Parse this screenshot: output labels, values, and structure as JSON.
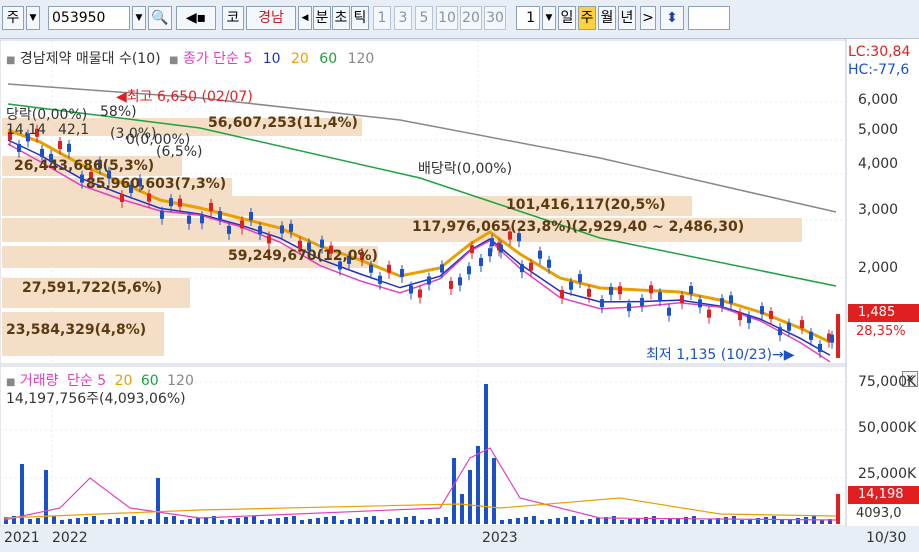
{
  "toolbar": {
    "market_label": "주",
    "code_value": "053950",
    "search_icon": "search-icon",
    "speaker_icon": "speaker-icon",
    "kosdaq_label": "코",
    "name_label": "경남",
    "prev_label": "◀",
    "minute_label": "분",
    "second_label": "초",
    "tick_label": "틱",
    "n1": "1",
    "n3": "3",
    "n5": "5",
    "n10": "10",
    "n20": "20",
    "n30": "30",
    "period_value": "1",
    "day_label": "일",
    "week_label": "주",
    "month_label": "월",
    "year_label": "년",
    "next_label": ">",
    "arrow_label": "⬍"
  },
  "price_panel": {
    "legend_title": "경남제약 매물대 수(10)",
    "legend_ma_label": "종가 단순 5",
    "ma10": "10",
    "ma20": "20",
    "ma60": "60",
    "ma120": "120",
    "lc_label": "LC:30,84",
    "hc_label": "HC:-77,6",
    "high_label": "최고 6,650 (02/07)",
    "low_label": "최저 1,135 (10/23)",
    "dividend_label": "배당락(0,00%)",
    "current_price": "1,485",
    "current_pct": "28,35%",
    "y_ticks": [
      "6,000",
      "5,000",
      "4,000",
      "3,000",
      "2,000"
    ],
    "volume_profile": [
      "56,607,253(11,4%)",
      "26,443,686(5,3%)",
      "85,960,603(7,3%)",
      "101,416,117(20,5%)",
      "117,976,065(23,8%)(2,929,40 ~ 2,486,30)",
      "59,249,670(12,0%)",
      "27,591,722(5,6%)",
      "23,584,329(4,8%)"
    ],
    "overlap_labels": [
      "당락(0,00%)",
      "14,14",
      "42,1",
      "58%)",
      "(3,0%)",
      "0(0,00%)",
      "(6,5%)"
    ]
  },
  "volume_panel": {
    "legend_title": "거래량",
    "legend_ma_label": "단순 5",
    "ma20": "20",
    "ma60": "60",
    "ma120": "120",
    "volume_value": "14,197,756주(4,093,06%)",
    "y_ticks": [
      "75,000K",
      "50,000K",
      "25,000K"
    ],
    "current_volume": "14,198",
    "current_pct": "4093,0"
  },
  "x_axis": {
    "labels": [
      "2021",
      "2022",
      "2023",
      "10/30"
    ]
  },
  "colors": {
    "up": "#e02020",
    "down": "#1a50c8",
    "ma5": "#e040c0",
    "ma10": "#2030c0",
    "ma20": "#e8a000",
    "ma60": "#20a040",
    "ma120": "#888888"
  }
}
